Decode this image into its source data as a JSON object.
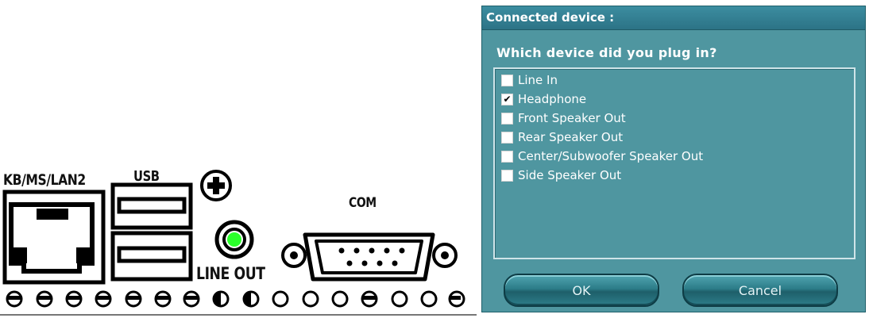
{
  "panel": {
    "labels": {
      "lan2": "KB/MS/LAN2",
      "usb": "USB",
      "com": "COM",
      "line_out": "LINE OUT"
    }
  },
  "dialog": {
    "title": "Connected device :",
    "question": "Which device did you plug in?",
    "options": [
      {
        "label": "Line In",
        "checked": false
      },
      {
        "label": "Headphone",
        "checked": true
      },
      {
        "label": "Front Speaker Out",
        "checked": false
      },
      {
        "label": "Rear Speaker Out",
        "checked": false
      },
      {
        "label": "Center/Subwoofer Speaker Out",
        "checked": false
      },
      {
        "label": "Side Speaker Out",
        "checked": false
      }
    ],
    "ok_label": "OK",
    "cancel_label": "Cancel",
    "colors": {
      "background": "#4f96a0",
      "titlebar": "#2c7386",
      "line_out_jack": "#2aff2a"
    }
  }
}
